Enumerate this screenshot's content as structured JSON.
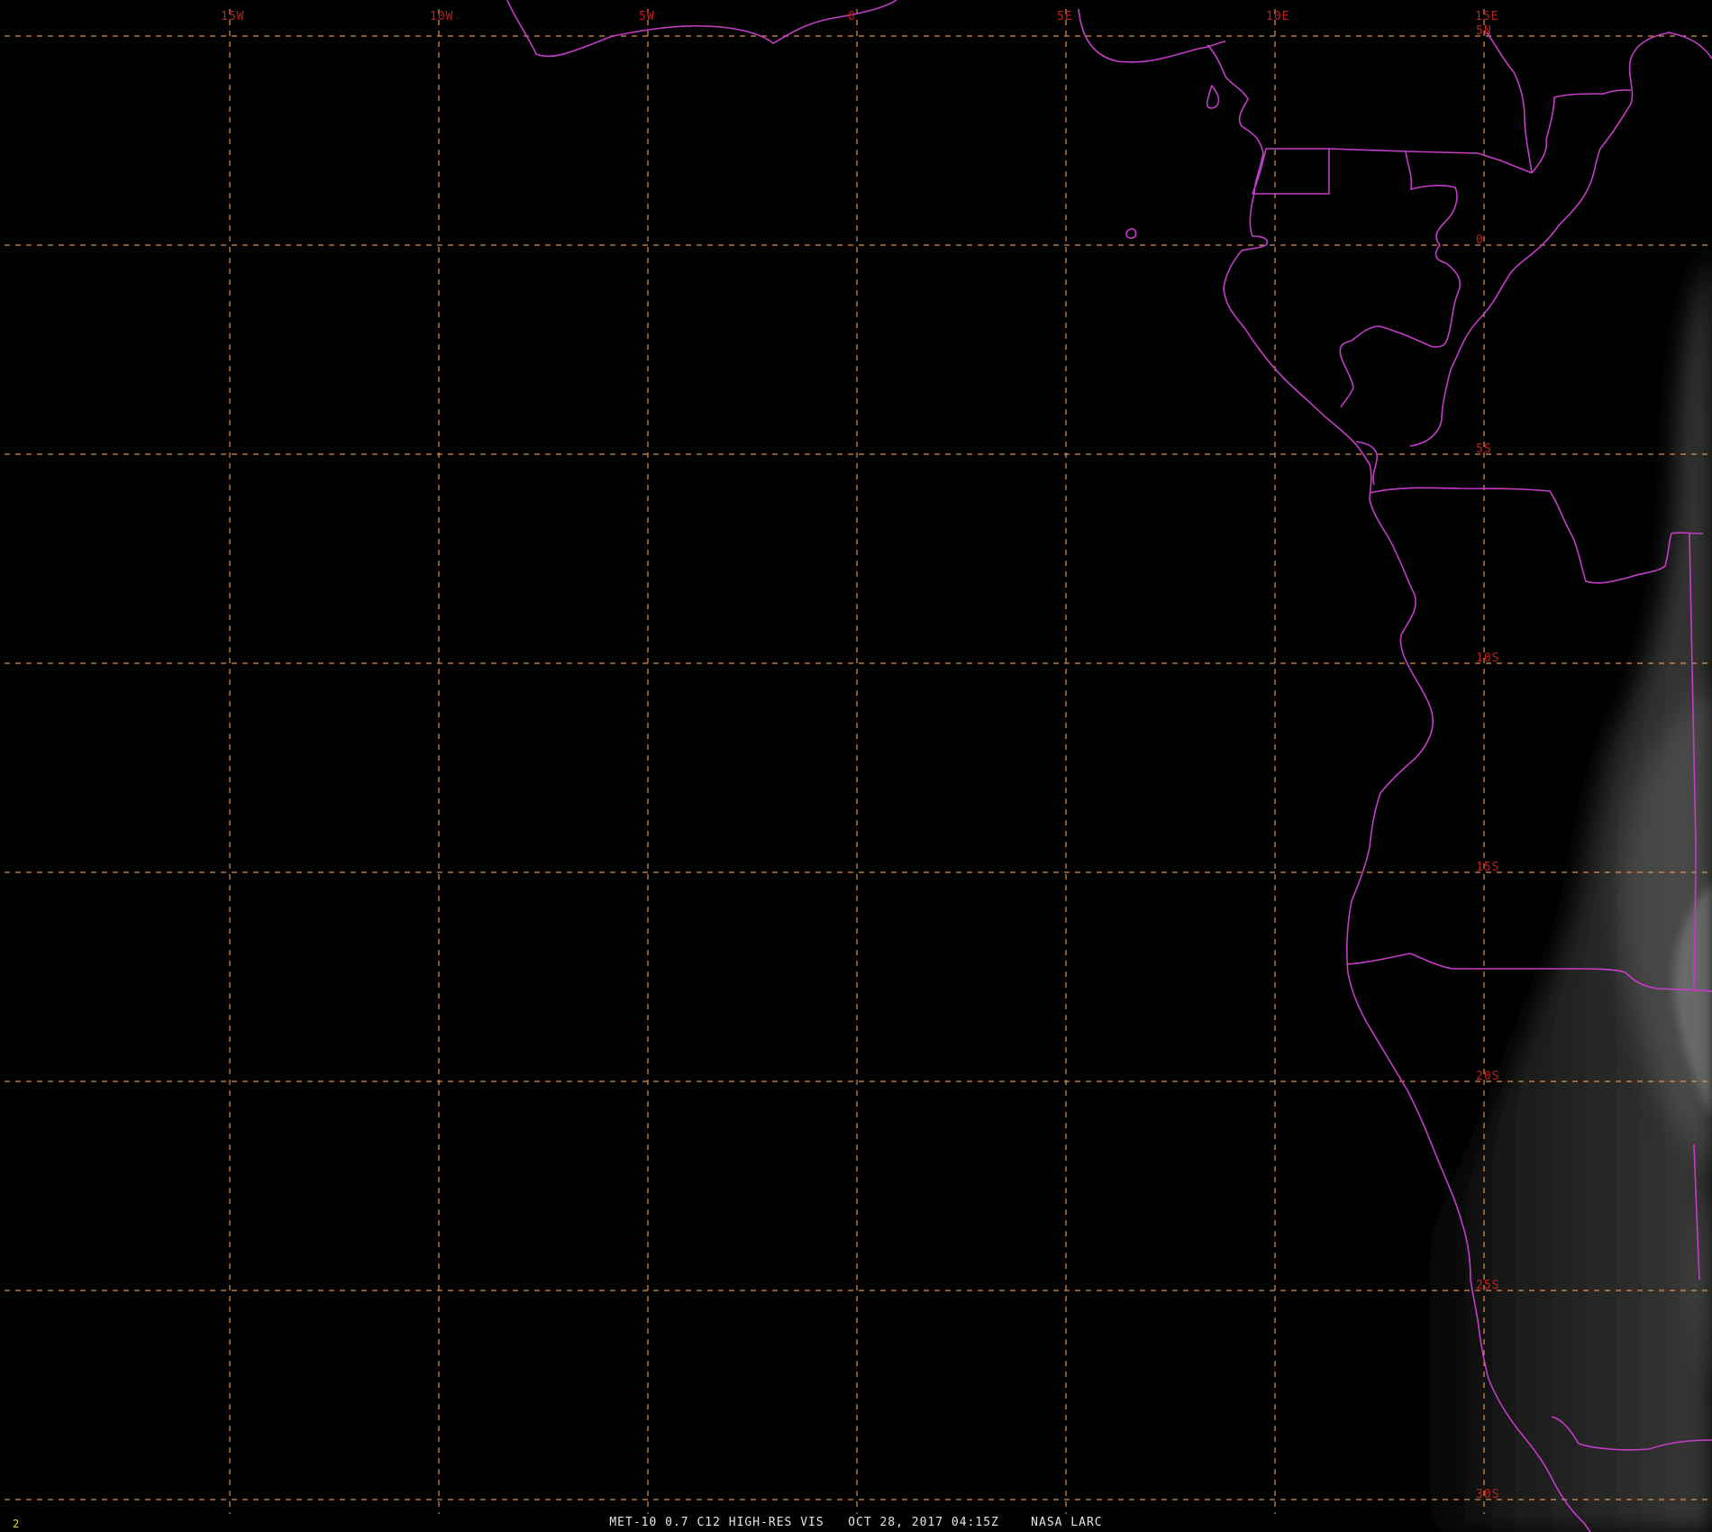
{
  "map": {
    "background_color": "#000000",
    "grid_color": "#d9944f",
    "boundary_color": "#c43dc8",
    "label_color": "#c0201c",
    "caption_color": "#e6e6e6",
    "frame_number_color": "#e8e000",
    "longitude_labels": [
      {
        "lon": -15,
        "text": "15W"
      },
      {
        "lon": -10,
        "text": "10W"
      },
      {
        "lon": -5,
        "text": "5W"
      },
      {
        "lon": 0,
        "text": "0"
      },
      {
        "lon": 5,
        "text": "5E"
      },
      {
        "lon": 10,
        "text": "10E"
      },
      {
        "lon": 15,
        "text": "15E"
      }
    ],
    "latitude_labels": [
      {
        "lat": 5,
        "text": "5N"
      },
      {
        "lat": 0,
        "text": "0"
      },
      {
        "lat": -5,
        "text": "5S"
      },
      {
        "lat": -10,
        "text": "10S"
      },
      {
        "lat": -15,
        "text": "15S"
      },
      {
        "lat": -20,
        "text": "20S"
      },
      {
        "lat": -25,
        "text": "25S"
      },
      {
        "lat": -30,
        "text": "30S"
      }
    ],
    "caption": "MET-10 0.7 C12 HIGH-RES VIS   OCT 28, 2017 04:15Z    NASA LARC",
    "frame_number": "2"
  }
}
